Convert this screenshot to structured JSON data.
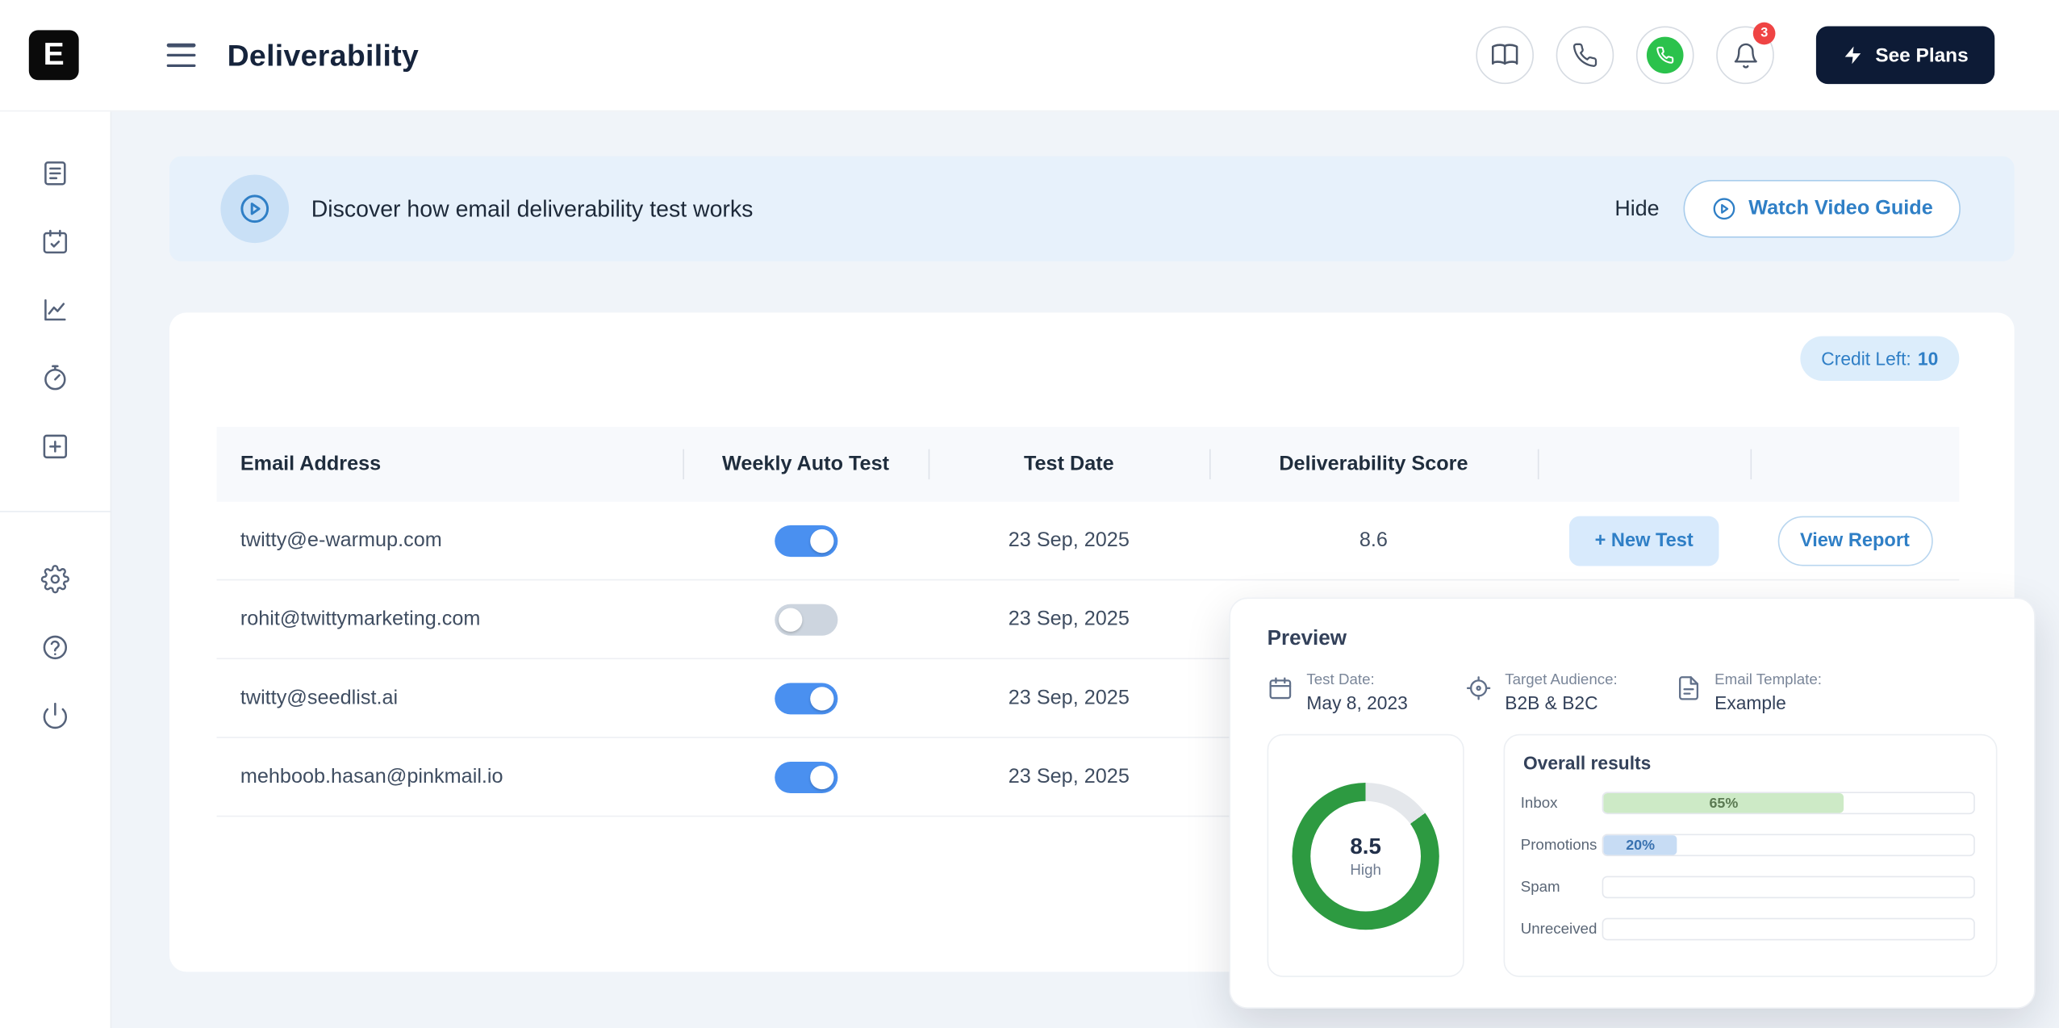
{
  "app": {
    "logo_letter": "E"
  },
  "header": {
    "title": "Deliverability",
    "see_plans": "See Plans",
    "notification_badge": "3"
  },
  "banner": {
    "text": "Discover how email deliverability test works",
    "hide": "Hide",
    "watch_video": "Watch Video Guide"
  },
  "credit_badge": {
    "label": "Credit Left:",
    "value": "10"
  },
  "table": {
    "headers": [
      "Email Address",
      "Weekly Auto Test",
      "Test Date",
      "Deliverability Score",
      "",
      ""
    ],
    "rows": [
      {
        "email": "twitty@e-warmup.com",
        "weekly_auto_test": true,
        "test_date": "23 Sep, 2025",
        "score": "8.6",
        "new_test_label": "+ New Test",
        "view_report_label": "View Report"
      },
      {
        "email": "rohit@twittymarketing.com",
        "weekly_auto_test": false,
        "test_date": "23 Sep, 2025"
      },
      {
        "email": "twitty@seedlist.ai",
        "weekly_auto_test": true,
        "test_date": "23 Sep, 2025"
      },
      {
        "email": "mehboob.hasan@pinkmail.io",
        "weekly_auto_test": true,
        "test_date": "23 Sep, 2025"
      }
    ]
  },
  "preview": {
    "title": "Preview",
    "info": [
      {
        "icon": "calendar-icon",
        "label": "Test Date:",
        "value": "May 8, 2023"
      },
      {
        "icon": "target-icon",
        "label": "Target Audience:",
        "value": "B2B & B2C"
      },
      {
        "icon": "file-icon",
        "label": "Email Template:",
        "value": "Example"
      }
    ],
    "gauge": {
      "score": "8.5",
      "level": "High",
      "percent": 85
    },
    "overall_results": {
      "title": "Overall results",
      "rows": [
        {
          "label": "Inbox",
          "value": 65,
          "display": "65%",
          "fill": "#cdeac6",
          "text_color": "#5b7a52"
        },
        {
          "label": "Promotions",
          "value": 20,
          "display": "20%",
          "fill": "#c7dcf4",
          "text_color": "#3a72b0"
        },
        {
          "label": "Spam",
          "value": 0,
          "display": ""
        },
        {
          "label": "Unreceived",
          "value": 0,
          "display": ""
        }
      ]
    }
  },
  "colors": {
    "accent_blue": "#2f7fc6",
    "toggle_on": "#4a90f0",
    "dark_button": "#0d1b36",
    "badge_red": "#ef4444",
    "whatsapp_green": "#2bc24c",
    "gauge_fill": "#2d9a41",
    "gauge_track": "#e4e7eb"
  }
}
